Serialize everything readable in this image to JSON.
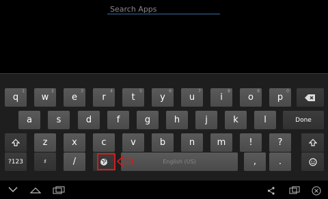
{
  "search": {
    "placeholder": "Search Apps"
  },
  "keyboard": {
    "row1": [
      {
        "label": "q",
        "hint": "1"
      },
      {
        "label": "w",
        "hint": "2"
      },
      {
        "label": "e",
        "hint": "3"
      },
      {
        "label": "r",
        "hint": "4"
      },
      {
        "label": "t",
        "hint": "5"
      },
      {
        "label": "y",
        "hint": "6"
      },
      {
        "label": "u",
        "hint": "7"
      },
      {
        "label": "i",
        "hint": "8"
      },
      {
        "label": "o",
        "hint": "9"
      },
      {
        "label": "p",
        "hint": "0"
      }
    ],
    "row2": [
      "a",
      "s",
      "d",
      "f",
      "g",
      "h",
      "j",
      "k",
      "l"
    ],
    "row3": [
      "z",
      "x",
      "c",
      "v",
      "b",
      "n",
      "m",
      "!",
      "?"
    ],
    "delete_icon": "backspace-icon",
    "done_label": "Done",
    "shift_icon": "shift-icon",
    "symbols_label": "?123",
    "settings_hint": "♯",
    "slash_label": "/",
    "language_icon": "globe-icon",
    "space_label": "English (US)",
    "comma_label": ",",
    "period_label": ".",
    "emoji_icon": "smiley-icon"
  },
  "highlight_color": "#d31d1d",
  "nav": {
    "icons": [
      "hide-keyboard-icon",
      "home-icon",
      "recent-apps-icon",
      "share-icon",
      "window-icon",
      "close-icon"
    ]
  }
}
